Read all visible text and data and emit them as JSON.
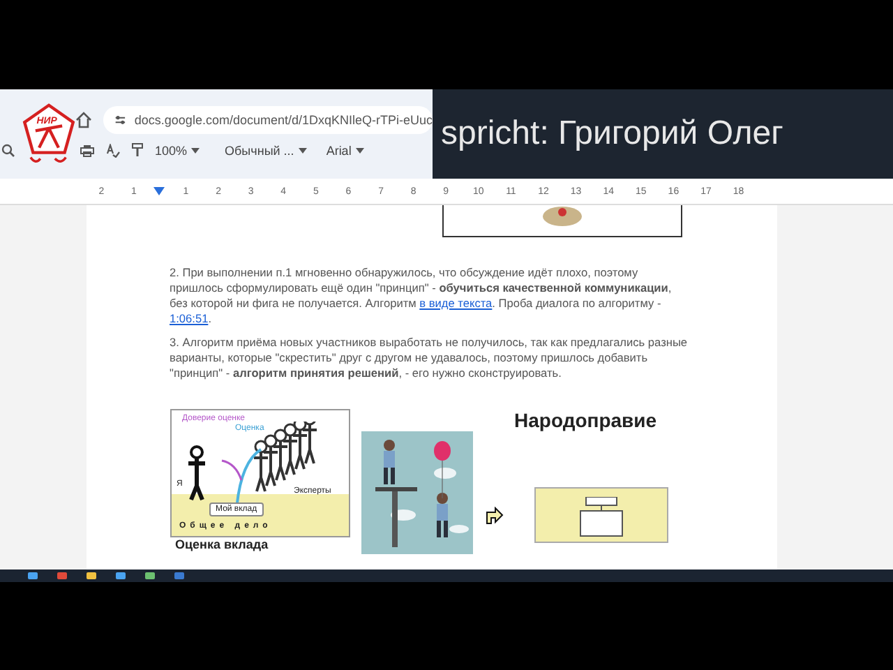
{
  "browser": {
    "url": "docs.google.com/document/d/1DxqKNIleQ-rTPi-eUuc"
  },
  "logo": {
    "text": "НИР"
  },
  "toolbar": {
    "zoom": "100%",
    "style": "Обычный ...",
    "font": "Arial"
  },
  "caption": {
    "text": "spricht: Григорий Олег"
  },
  "ruler": {
    "left_numbers": [
      "2",
      "1"
    ],
    "right_numbers": [
      "1",
      "2",
      "3",
      "4",
      "5",
      "6",
      "7",
      "8",
      "9",
      "10",
      "11",
      "12",
      "13",
      "14",
      "15",
      "16",
      "17",
      "18"
    ]
  },
  "document": {
    "paragraphs": [
      [
        {
          "kind": "text",
          "text": "2. При выполнении п.1 мгновенно обнаружилось, что обсуждение идёт плохо, поэтому пришлось сформулировать ещё один \"принцип\" - **обучиться качественной коммуникации**, без которой ни фига не получается. Алгоритм "
        },
        {
          "kind": "link",
          "text": "в виде текста"
        },
        {
          "kind": "text",
          "text": ". Проба диалога по алгоритму - "
        },
        {
          "kind": "link",
          "text": "1:06:51"
        },
        {
          "kind": "text",
          "text": "."
        }
      ],
      [
        {
          "kind": "text",
          "text": "3. Алгоритм приёма новых участников выработать не получилось, так как предлагались разные варианты, которые \"скрестить\" друг с другом не удавалось, поэтому пришлось добавить \"принцип\" - **алгоритм принятия решений**, - его нужно сконструировать."
        }
      ]
    ],
    "diagram": {
      "trust": "Доверие оценке",
      "rating": "Оценка",
      "me": "Я",
      "experts": "Эксперты",
      "contribution": "Мой вклад",
      "common": "Общее дело",
      "caption": "Оценка вклада"
    },
    "heading": "Народоправие"
  }
}
